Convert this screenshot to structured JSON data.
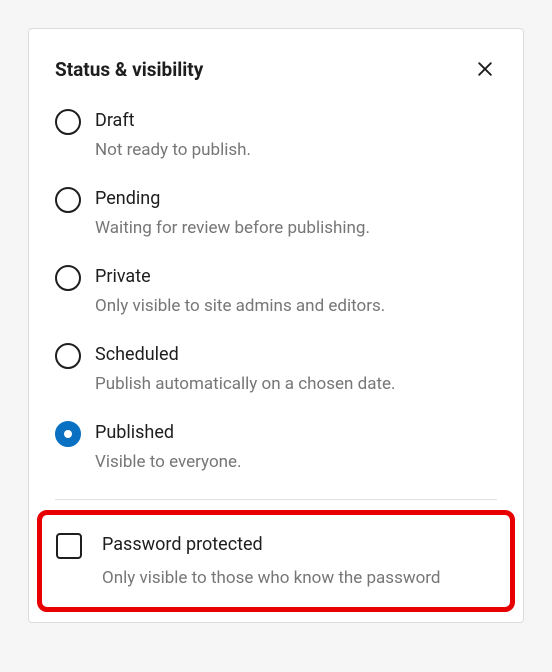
{
  "panel": {
    "title": "Status & visibility"
  },
  "options": [
    {
      "label": "Draft",
      "desc": "Not ready to publish.",
      "selected": false
    },
    {
      "label": "Pending",
      "desc": "Waiting for review before publishing.",
      "selected": false
    },
    {
      "label": "Private",
      "desc": "Only visible to site admins and editors.",
      "selected": false
    },
    {
      "label": "Scheduled",
      "desc": "Publish automatically on a chosen date.",
      "selected": false
    },
    {
      "label": "Published",
      "desc": "Visible to everyone.",
      "selected": true
    }
  ],
  "password": {
    "label": "Password protected",
    "desc": "Only visible to those who know the password",
    "checked": false
  },
  "highlight_color": "#e80000",
  "accent_color": "#0a71c2"
}
